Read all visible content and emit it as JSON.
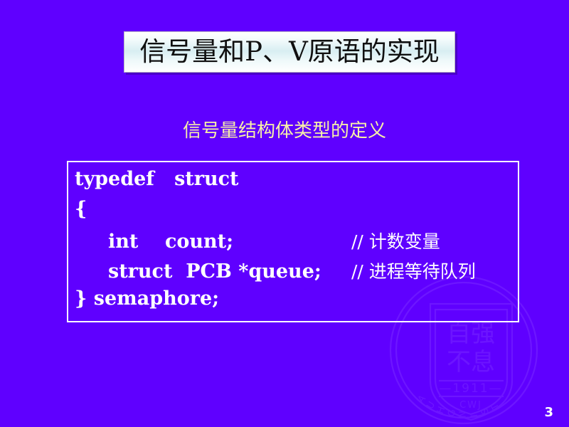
{
  "slide": {
    "background_color": "#5F00FF",
    "title": "信号量和P、V原语的实现",
    "subtitle": "信号量结构体类型的定义",
    "subtitle_color": "#F7F0A8",
    "page_number": "3"
  },
  "code_block": {
    "border_color": "#FFFFFF",
    "text_color": "#FFFFFF",
    "lines": [
      {
        "code": "typedef   struct",
        "comment": ""
      },
      {
        "code": "{",
        "comment": ""
      },
      {
        "code": "     int    count;",
        "comment": "// 计数变量"
      },
      {
        "code": "     struct  PCB *queue;",
        "comment": "// 进程等待队列"
      },
      {
        "code": "} semaphore;",
        "comment": ""
      }
    ]
  },
  "watermark": {
    "name": "tsinghua-university-seal",
    "outer_ring_text": "TSINGHUA UNIVERSITY",
    "year": "1911",
    "inner_text_top": "自强",
    "inner_text_bottom": "不息",
    "bottom_mark": "CWJ"
  }
}
